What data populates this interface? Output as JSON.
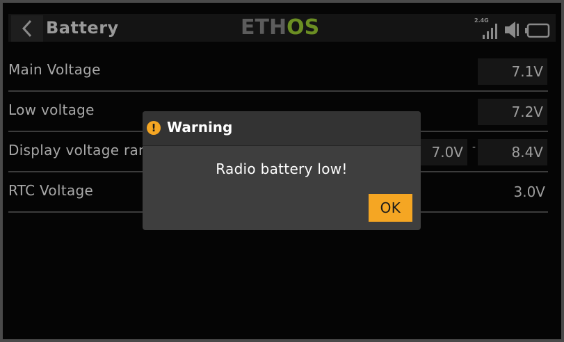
{
  "header": {
    "title": "Battery",
    "logo_left": "ETH",
    "logo_right": "OS",
    "band_label": "2.4G",
    "icons": [
      "back-chevron-icon",
      "signal-bars-icon",
      "speaker-icon",
      "battery-icon"
    ]
  },
  "rows": [
    {
      "label": "Main Voltage",
      "value": "7.1V"
    },
    {
      "label": "Low voltage",
      "value": "7.2V"
    },
    {
      "label": "Display voltage range",
      "min": "7.0V",
      "separator": "-",
      "max": "8.4V"
    },
    {
      "label": "RTC Voltage",
      "value": "3.0V"
    }
  ],
  "dialog": {
    "icon": "!",
    "title": "Warning",
    "message": "Radio battery low!",
    "ok_label": "OK"
  },
  "colors": {
    "accent": "#f5a623",
    "logo_green": "#6b8e23",
    "background": "#050505",
    "dialog_bg": "#3e3e3e"
  }
}
